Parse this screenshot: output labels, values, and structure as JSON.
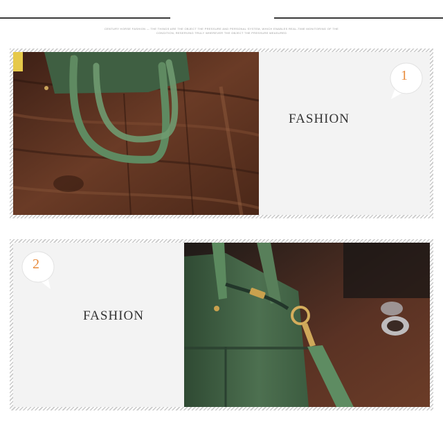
{
  "header": {
    "tagline": "Century Horse Fashion — the things are the object the pressure and personal system, which enables real-time monitoring of the condition; reserving truly wherever the object the pressure measured"
  },
  "panels": [
    {
      "number": "1",
      "caption": "FASHION"
    },
    {
      "number": "2",
      "caption": "FASHION"
    }
  ],
  "colors": {
    "accent_number": "#e88b3b",
    "bag_green": "#4f7250",
    "wood": "#5a3422"
  }
}
